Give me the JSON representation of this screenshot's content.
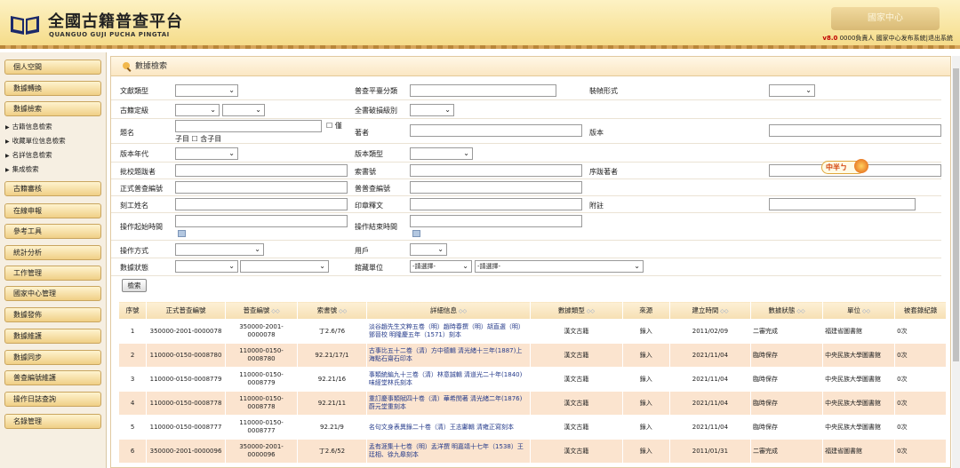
{
  "header": {
    "title": "全國古籍普查平台",
    "subtitle": "QUANGUO GUJI PUCHA PINGTAI",
    "deco_text": "國家中心",
    "version": "v8.0",
    "user_text": " 0000負責人 國家中心发布系統|",
    "logout": "退出系統"
  },
  "sidebar": {
    "items": [
      {
        "label": "個人空間"
      },
      {
        "label": "數據轉換"
      },
      {
        "label": "數據檢索"
      },
      {
        "label": "古籍審核"
      },
      {
        "label": "在線申報"
      },
      {
        "label": "參考工具"
      },
      {
        "label": "統計分析"
      },
      {
        "label": "工作管理"
      },
      {
        "label": "國家中心管理"
      },
      {
        "label": "數據發佈"
      },
      {
        "label": "數據維護"
      },
      {
        "label": "數據同步"
      },
      {
        "label": "普查編號維護"
      },
      {
        "label": "操作日誌查詢"
      },
      {
        "label": "名錄管理"
      }
    ],
    "subitems": [
      "古籍信息檢索",
      "收藏單位信息檢索",
      "名詳信息檢索",
      "集成檢索"
    ]
  },
  "panel": {
    "title": "數據檢索"
  },
  "form": {
    "labels": {
      "doc_type": "文獻類型",
      "pucha_class": "普查平臺分類",
      "binding": "裝幀形式",
      "grade": "古籍定級",
      "damage": "全書破損級別",
      "title": "題名",
      "title_only": "僅",
      "zimu": "子目",
      "contain_zimu": "含子目",
      "author": "著者",
      "edition": "版本",
      "edition_era": "版本年代",
      "edition_type": "版本類型",
      "annotator": "批校題跋者",
      "call_no": "索書號",
      "preface": "序跋著者",
      "formal_no": "正式普查編號",
      "census_no": "普普查編號",
      "engraver": "刻工姓名",
      "seal": "印章釋文",
      "note": "附註",
      "op_start": "操作起始時間",
      "op_end": "操作結束時間",
      "op_mode": "操作方式",
      "user": "用戶",
      "data_status": "數據狀態",
      "holding_unit": "館藏單位"
    },
    "holding_sel1": "-請選擇-",
    "holding_sel2": "-請選擇-",
    "search_button": "檢索",
    "ime_text": "中半ㄅ"
  },
  "table": {
    "headers": [
      "序號",
      "正式普查編號",
      "普查編號",
      "索書號",
      "詳細信息",
      "數據類型",
      "來源",
      "建立時間",
      "數據狀態",
      "單位",
      "被套錄紀錄"
    ],
    "sortable": [
      false,
      false,
      true,
      true,
      true,
      true,
      false,
      true,
      true,
      true,
      false
    ],
    "rows": [
      {
        "no": "1",
        "formal": "350000-2001-0000078",
        "census": "350000-2001-0000078",
        "call": "丁2.6/76",
        "detail": "淡谷趙先生文粹五卷（明）趙時春撰（明）胡直選（明）鄧晉校 明隆慶五年（1571）刻本",
        "type": "漢文古籍",
        "source": "錄入",
        "date": "2011/02/09",
        "status": "二審完成",
        "unit": "福建省圖書館",
        "copied": "0次"
      },
      {
        "no": "2",
        "formal": "110000-0150-0008780",
        "census": "110000-0150-0008780",
        "call": "92.21/17/1",
        "detail": "古事比五十二卷（清）方中德輯 清光緒十三年(1887)上海點石齋石印本",
        "type": "漢文古籍",
        "source": "錄入",
        "date": "2021/11/04",
        "status": "臨時保存",
        "unit": "中央民族大學圖書館",
        "copied": "0次"
      },
      {
        "no": "3",
        "formal": "110000-0150-0008779",
        "census": "110000-0150-0008779",
        "call": "92.21/16",
        "detail": "事類統編九十三卷（清）林意誠輯 清道光二十年(1840)味經堂林氏刻本",
        "type": "漢文古籍",
        "source": "錄入",
        "date": "2021/11/04",
        "status": "臨時保存",
        "unit": "中央民族大學圖書館",
        "copied": "0次"
      },
      {
        "no": "4",
        "formal": "110000-0150-0008778",
        "census": "110000-0150-0008778",
        "call": "92.21/11",
        "detail": "重訂慶事類賦四十卷（清）華希閔著 清光緒二年(1876)蔚元堂重刻本",
        "type": "漢文古籍",
        "source": "錄入",
        "date": "2021/11/04",
        "status": "臨時保存",
        "unit": "中央民族大學圖書館",
        "copied": "0次"
      },
      {
        "no": "5",
        "formal": "110000-0150-0008777",
        "census": "110000-0150-0008777",
        "call": "92.21/9",
        "detail": "名句文身表異錄二十卷（清）王志鄘輯 清雍正寫刻本",
        "type": "漢文古籍",
        "source": "錄入",
        "date": "2021/11/04",
        "status": "臨時保存",
        "unit": "中央民族大學圖書館",
        "copied": "0次"
      },
      {
        "no": "6",
        "formal": "350000-2001-0000096",
        "census": "350000-2001-0000096",
        "call": "丁2.6/52",
        "detail": "孟有涯集十七卷（明）孟洋撰 明嘉靖十七年（1538）王廷相、徐九皋刻本",
        "type": "漢文古籍",
        "source": "錄入",
        "date": "2011/01/31",
        "status": "二審完成",
        "unit": "福建省圖書館",
        "copied": "0次"
      }
    ]
  },
  "colors": {
    "accent": "#c00000",
    "header_bg": "#f5dc8a",
    "row_alt": "#fbe4cf",
    "link": "#243a8a"
  }
}
